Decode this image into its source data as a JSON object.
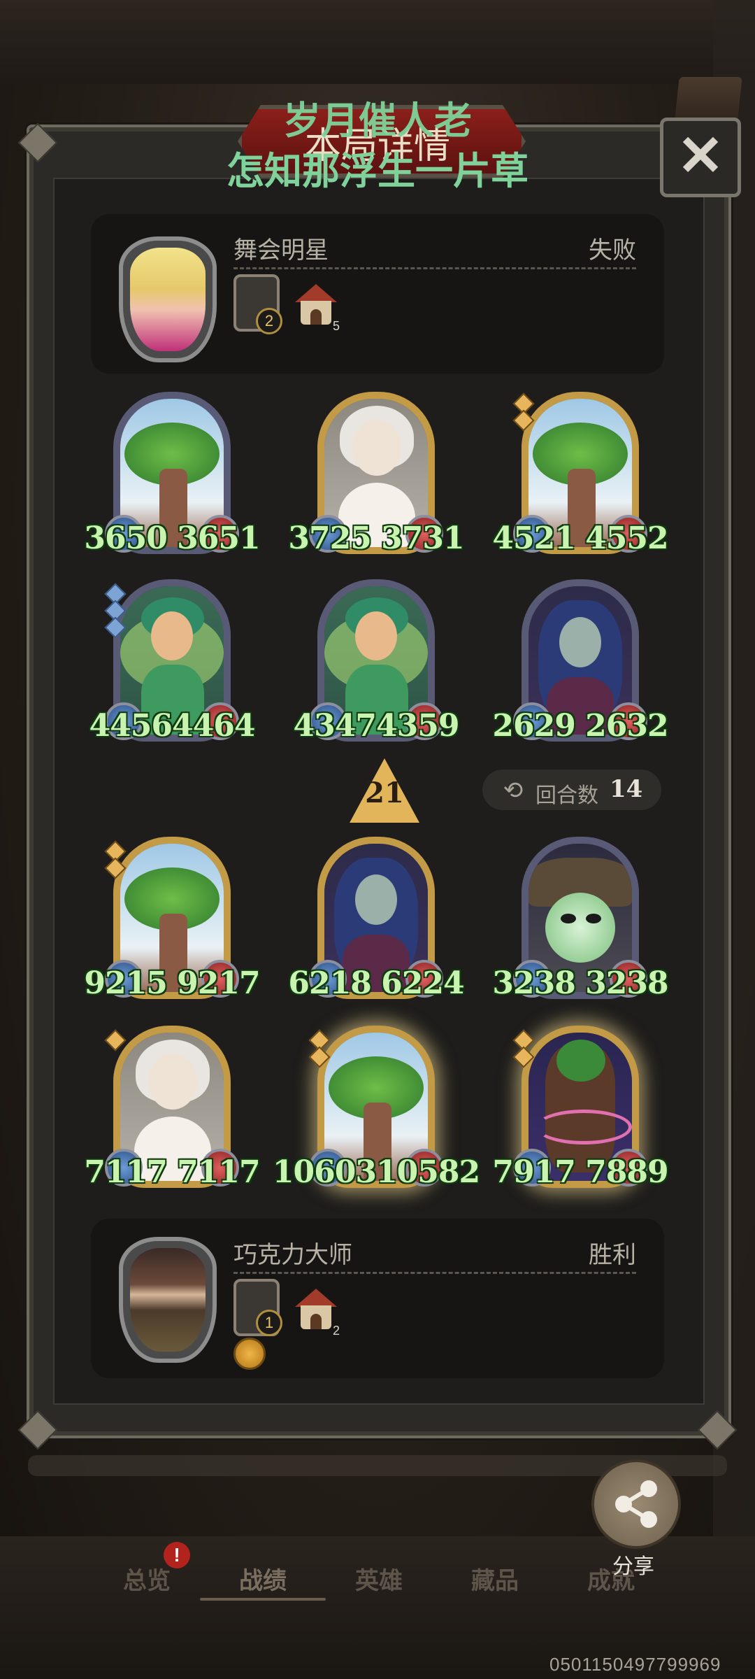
{
  "overlay": {
    "line1": "岁月催人老",
    "line2": "怎知那浮生一片草"
  },
  "header": {
    "title": "本局详情",
    "close_glyph": "✕"
  },
  "top_player": {
    "name": "舞会明星",
    "result": "失败",
    "badge_count": "2",
    "house_count": "5"
  },
  "top_units": [
    {
      "stats": "3650 3651",
      "art": "tree"
    },
    {
      "stats": "3725 3731",
      "art": "person-white"
    },
    {
      "stats": "4521 4552",
      "art": "tree"
    },
    {
      "stats": "44564464",
      "art": "fairy"
    },
    {
      "stats": "43474359",
      "art": "fairy"
    },
    {
      "stats": "2629 2632",
      "art": "elf"
    }
  ],
  "round": {
    "arrow_value": "21",
    "label": "回合数",
    "value": "14",
    "icon": "refresh-icon"
  },
  "bottom_units": [
    {
      "stats": "9215 9217",
      "art": "tree"
    },
    {
      "stats": "6218 6224",
      "art": "elf"
    },
    {
      "stats": "3238 3238",
      "art": "ghost"
    },
    {
      "stats": "7117  7117",
      "art": "person-white"
    },
    {
      "stats": "1060310582",
      "art": "tree"
    },
    {
      "stats": "7917 7889",
      "art": "treant"
    }
  ],
  "bottom_player": {
    "name": "巧克力大师",
    "result": "胜利",
    "badge_count": "1",
    "house_count": "2"
  },
  "share": {
    "label": "分享",
    "icon": "share-icon"
  },
  "tabs": [
    {
      "label": "总览"
    },
    {
      "label": "战绩"
    },
    {
      "label": "英雄"
    },
    {
      "label": "藏品"
    },
    {
      "label": "成就"
    }
  ],
  "tab_alert": "!",
  "footer_id": "0501150497799969",
  "colors": {
    "stat_text": "#c8f4b0",
    "overlay_text": "#7fd39a",
    "gold_frame": "#c39a45",
    "silver_frame": "#595a75"
  }
}
